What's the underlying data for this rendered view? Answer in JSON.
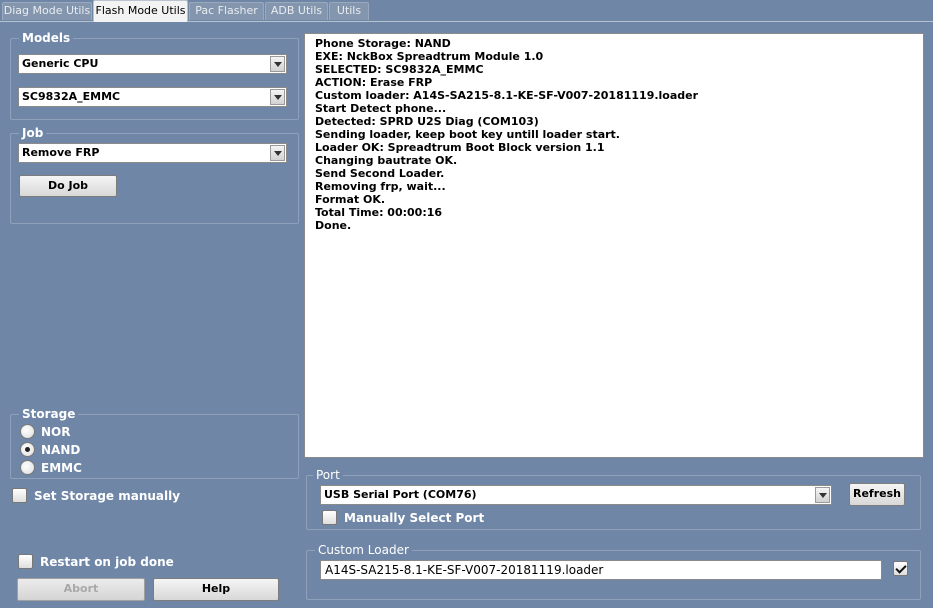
{
  "tabs": [
    {
      "label": "Diag Mode Utils",
      "active": false
    },
    {
      "label": "Flash Mode Utils",
      "active": true
    },
    {
      "label": "Pac Flasher",
      "active": false
    },
    {
      "label": "ADB Utils",
      "active": false
    },
    {
      "label": "Utils",
      "active": false
    }
  ],
  "models": {
    "title": "Models",
    "cpu_selected": "Generic CPU",
    "model_selected": "SC9832A_EMMC"
  },
  "job": {
    "title": "Job",
    "selected": "Remove FRP",
    "do_job_label": "Do Job"
  },
  "storage": {
    "title": "Storage",
    "options": [
      {
        "label": "NOR",
        "checked": false
      },
      {
        "label": "NAND",
        "checked": true
      },
      {
        "label": "EMMC",
        "checked": false
      }
    ],
    "set_manually_label": "Set Storage manually",
    "set_manually_checked": false
  },
  "restart_label": "Restart on job done",
  "restart_checked": false,
  "abort_label": "Abort",
  "help_label": "Help",
  "log": [
    "Phone Storage: NAND",
    "EXE: NckBox Spreadtrum Module 1.0",
    "SELECTED: SC9832A_EMMC",
    "ACTION: Erase FRP",
    "Custom loader: A14S-SA215-8.1-KE-SF-V007-20181119.loader",
    "Start Detect phone...",
    "Detected: SPRD U2S Diag (COM103)",
    "Sending loader, keep boot key untill loader start.",
    "Loader OK: Spreadtrum Boot Block version 1.1",
    "Changing bautrate OK.",
    "Send Second Loader.",
    "Removing frp, wait...",
    "Format OK.",
    "Total Time: 00:00:16",
    "Done."
  ],
  "port": {
    "title": "Port",
    "selected": "USB Serial Port (COM76)",
    "refresh_label": "Refresh",
    "manual_label": "Manually Select Port",
    "manual_checked": false
  },
  "custom_loader": {
    "title": "Custom Loader",
    "value": "A14S-SA215-8.1-KE-SF-V007-20181119.loader",
    "enabled_checked": true
  }
}
